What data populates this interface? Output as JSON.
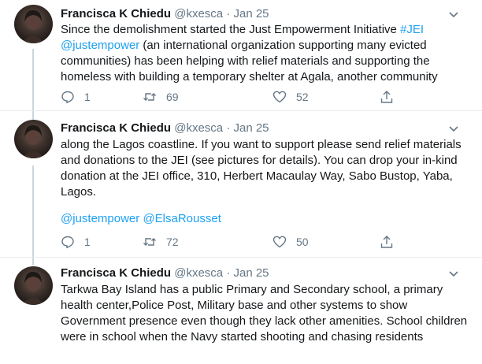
{
  "tweets": [
    {
      "name": "Francisca K Chiedu",
      "handle": "@kxesca",
      "sep": "·",
      "date": "Jan 25",
      "text_a": "Since the demolishment started the Just Empowerment Initiative ",
      "hashtag": "#JEI",
      "mention": "@justempower",
      "text_b": " (an international organization supporting many evicted communities) has been helping with relief materials and supporting the homeless with building a temporary shelter at Agala, another community",
      "replies": "1",
      "retweets": "69",
      "likes": "52"
    },
    {
      "name": "Francisca K Chiedu",
      "handle": "@kxesca",
      "sep": "·",
      "date": "Jan 25",
      "text": "along the Lagos coastline. If you want to support please send relief materials and donations to the JEI (see pictures for details). You can drop your in-kind donation at the JEI office, 310, Herbert Macaulay Way, Sabo Bustop, Yaba, Lagos.",
      "mention_1": "@justempower",
      "mention_2": "@ElsaRousset",
      "replies": "1",
      "retweets": "72",
      "likes": "50"
    },
    {
      "name": "Francisca K Chiedu",
      "handle": "@kxesca",
      "sep": "·",
      "date": "Jan 25",
      "text": "Tarkwa Bay Island has a public Primary and Secondary school, a primary health center,Police Post, Military base and other systems to show Government presence even though they lack other amenities. School children were in school when the Navy started shooting and chasing residents"
    }
  ],
  "icons": {
    "reply": "reply-icon",
    "retweet": "retweet-icon",
    "like": "heart-icon",
    "share": "share-icon",
    "more": "chevron-down-icon"
  },
  "colors": {
    "link": "#1da1f2",
    "secondary_text": "#657786",
    "thread_line": "#ccd6dd"
  }
}
